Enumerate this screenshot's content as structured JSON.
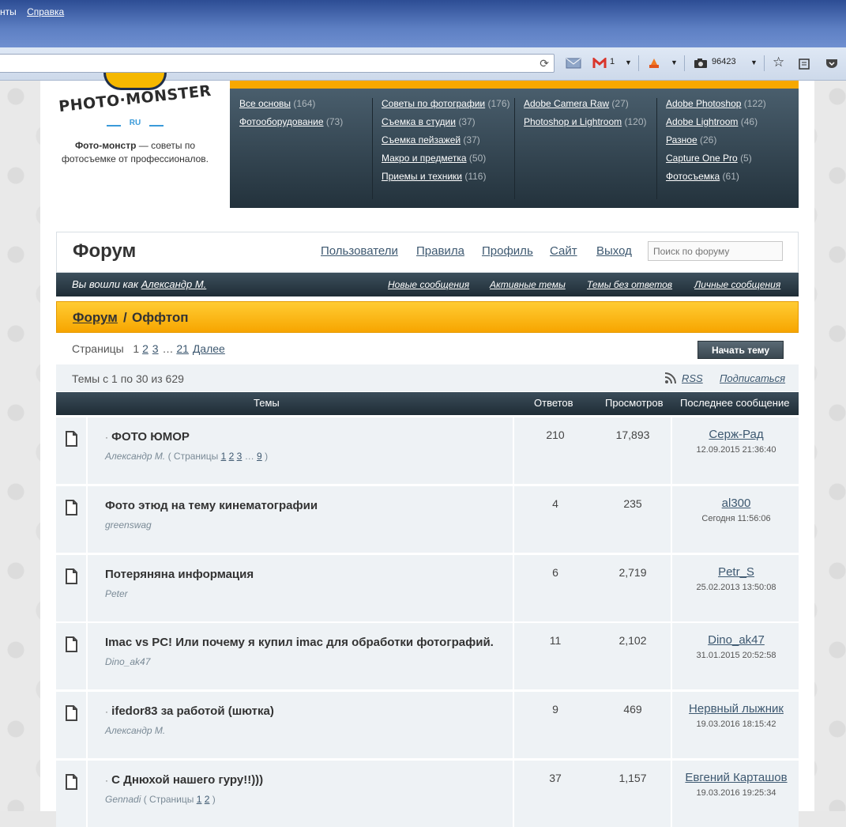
{
  "browser": {
    "menu": [
      "нты",
      "Справка"
    ],
    "mail_count": "1",
    "counter": "96423"
  },
  "site": {
    "logo_text": "PHOTO·MONSTER",
    "logo_ru": "RU",
    "tagline_bold": "Фото-монстр",
    "tagline_rest": " — советы по фотосъемке от профессионалов."
  },
  "categories": [
    [
      {
        "label": "Все основы",
        "count": "(164)"
      },
      {
        "label": "Фотооборудование",
        "count": "(73)"
      }
    ],
    [
      {
        "label": "Советы по фотографии",
        "count": "(176)"
      },
      {
        "label": "Съемка в студии",
        "count": "(37)"
      },
      {
        "label": "Съемка пейзажей",
        "count": "(37)"
      },
      {
        "label": "Макро и предметка",
        "count": "(50)"
      },
      {
        "label": "Приемы и техники",
        "count": "(116)"
      }
    ],
    [
      {
        "label": "Adobe Camera Raw",
        "count": "(27)"
      },
      {
        "label": "Photoshop и Lightroom",
        "count": "(120)"
      }
    ],
    [
      {
        "label": "Adobe Photoshop",
        "count": "(122)"
      },
      {
        "label": "Adobe Lightroom",
        "count": "(46)"
      },
      {
        "label": "Разное",
        "count": "(26)"
      },
      {
        "label": "Capture One Pro",
        "count": "(5)"
      },
      {
        "label": "Фотосъемка",
        "count": "(61)"
      }
    ]
  ],
  "forum": {
    "title": "Форум",
    "nav": [
      "Пользователи",
      "Правила",
      "Профиль",
      "Сайт",
      "Выход"
    ],
    "search_placeholder": "Поиск по форуму",
    "logged_in_prefix": "Вы вошли как",
    "logged_in_user": "Александр М.",
    "user_links": [
      "Новые сообщения",
      "Активные темы",
      "Темы без ответов",
      "Личные сообщения"
    ],
    "breadcrumb_root": "Форум",
    "breadcrumb_sep": "/",
    "breadcrumb_current": "Оффтоп",
    "pages_label": "Страницы",
    "pages": [
      "1",
      "2",
      "3",
      "…",
      "21"
    ],
    "next_label": "Далее",
    "start_topic": "Начать тему",
    "count_text": "Темы с 1 по 30 из 629",
    "rss": "RSS",
    "subscribe": "Подписаться",
    "columns": [
      "Темы",
      "Ответов",
      "Просмотров",
      "Последнее сообщение"
    ]
  },
  "topics": [
    {
      "prefix": "·",
      "title": "ФОТО ЮМОР",
      "author": "Александр М.",
      "pages_open": "( Страницы",
      "pages": [
        "1",
        "2",
        "3"
      ],
      "ellipsis": "…",
      "last_page": "9",
      "pages_close": ")",
      "replies": "210",
      "views": "17,893",
      "last_user": "Серж-Рад",
      "last_date": "12.09.2015 21:36:40"
    },
    {
      "prefix": "",
      "title": "Фото этюд на тему кинематографии",
      "author": "greenswag",
      "replies": "4",
      "views": "235",
      "last_user": "al300",
      "last_date": "Сегодня 11:56:06"
    },
    {
      "prefix": "",
      "title": "Потеряняна информация",
      "author": "Peter",
      "replies": "6",
      "views": "2,719",
      "last_user": "Petr_S",
      "last_date": "25.02.2013 13:50:08"
    },
    {
      "prefix": "",
      "title": "Imac vs PC! Или почему я купил imac для обработки фотографий.",
      "author": "Dino_ak47",
      "replies": "11",
      "views": "2,102",
      "last_user": "Dino_ak47",
      "last_date": "31.01.2015 20:52:58"
    },
    {
      "prefix": "·",
      "title": "ifedor83 за работой (шютка)",
      "author": "Александр М.",
      "replies": "9",
      "views": "469",
      "last_user": "Нервный лыжник",
      "last_date": "19.03.2016 18:15:42"
    },
    {
      "prefix": "·",
      "title": "С Днюхой нашего гуру!!)))",
      "author": "Gennadi",
      "pages_open": "( Страницы",
      "pages": [
        "1",
        "2"
      ],
      "pages_close": ")",
      "replies": "37",
      "views": "1,157",
      "last_user": "Евгений Карташов",
      "last_date": "19.03.2016 19:25:34"
    }
  ],
  "icons": {
    "reload": "reload-icon",
    "mail": "mail-icon",
    "gmail": "gmail-icon",
    "camera": "camera-icon",
    "star": "star-icon",
    "rss": "rss-icon",
    "topic": "document-icon"
  },
  "colors": {
    "accent": "#f7a800",
    "nav_dark": "#23323c",
    "link": "#3d5870"
  }
}
